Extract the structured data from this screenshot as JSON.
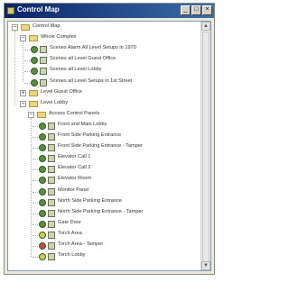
{
  "window": {
    "title": "Control Map",
    "min_glyph": "_",
    "max_glyph": "□",
    "close_glyph": "×"
  },
  "tree": [
    {
      "label": "Control Map",
      "icon": "folder-icon",
      "expanded": true
    },
    {
      "label": "Whole Complex",
      "icon": "folder-icon",
      "expanded": true
    },
    {
      "label": "Scenes Alarm All Level Setups in 1970",
      "icon": "scene-icon"
    },
    {
      "label": "Scenes all Level Guest Office",
      "icon": "scene-icon"
    },
    {
      "label": "Scenes all Level Lobby",
      "icon": "scene-icon"
    },
    {
      "label": "Scenes all Level Setups in 1st Street",
      "icon": "scene-icon"
    },
    {
      "label": "Level Guest Office",
      "icon": "folder-icon",
      "expanded": false
    },
    {
      "label": "Level Lobby",
      "icon": "folder-icon",
      "expanded": true
    },
    {
      "label": "Access Control Panels",
      "icon": "folder-icon",
      "expanded": true
    },
    {
      "label": "Front and Main Lobby",
      "icon": "scene-icon"
    },
    {
      "label": "Front Side Parking Entrance",
      "icon": "scene-icon"
    },
    {
      "label": "Front Side Parking Entrance - Tamper",
      "icon": "scene-icon"
    },
    {
      "label": "Elevator Call 1",
      "icon": "scene-icon"
    },
    {
      "label": "Elevator Call 2",
      "icon": "scene-icon"
    },
    {
      "label": "Elevator Room",
      "icon": "scene-icon"
    },
    {
      "label": "Monitor Panel",
      "icon": "scene-icon"
    },
    {
      "label": "North Side Parking Entrance",
      "icon": "scene-icon"
    },
    {
      "label": "North Side Parking Entrance - Tamper",
      "icon": "scene-icon"
    },
    {
      "label": "Gate Door",
      "icon": "scene-icon"
    },
    {
      "label": "Torch Area",
      "icon": "scene-icon-yellow"
    },
    {
      "label": "Torch Area - Tamper",
      "icon": "scene-icon-red"
    },
    {
      "label": "Torch Lobby",
      "icon": "scene-icon-yellow"
    }
  ],
  "colors": {
    "scene_green": "#5a8f3a",
    "scene_yellow": "#d8c84a",
    "scene_red": "#c8463a"
  }
}
